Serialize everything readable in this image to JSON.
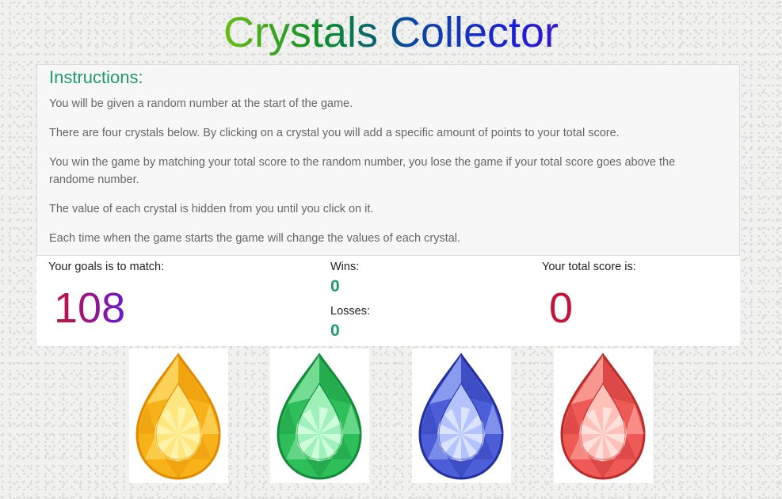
{
  "title": "Crystals Collector",
  "instructions": {
    "heading": "Instructions:",
    "paragraphs": [
      "You will be given a random number at the start of the game.",
      "There are four crystals below. By clicking on a crystal you will add a specific amount of points to your total score.",
      "You win the game by matching your total score to the random number, you lose the game if your total score goes above the randome number.",
      "The value of each crystal is hidden from you until you click on it.",
      "Each time when the game starts the game will change the values of each crystal."
    ]
  },
  "goal": {
    "label": "Your goals is to match:",
    "value": "108"
  },
  "record": {
    "wins_label": "Wins:",
    "wins": "0",
    "losses_label": "Losses:",
    "losses": "0"
  },
  "score": {
    "label": "Your total score is:",
    "value": "0"
  },
  "crystals": [
    {
      "name": "yellow",
      "colors": {
        "dark": "#e08a00",
        "mid": "#f7b21a",
        "light": "#ffe680",
        "core": "#fff3b0"
      }
    },
    {
      "name": "green",
      "colors": {
        "dark": "#138a3a",
        "mid": "#2fbf5a",
        "light": "#9ff0b8",
        "core": "#d6ffe2"
      }
    },
    {
      "name": "blue",
      "colors": {
        "dark": "#2530a0",
        "mid": "#4c5fd8",
        "light": "#b3c3ff",
        "core": "#e3e9ff"
      }
    },
    {
      "name": "red",
      "colors": {
        "dark": "#b92c2c",
        "mid": "#ee5a55",
        "light": "#ffc0b8",
        "core": "#ffe6e2"
      }
    }
  ]
}
